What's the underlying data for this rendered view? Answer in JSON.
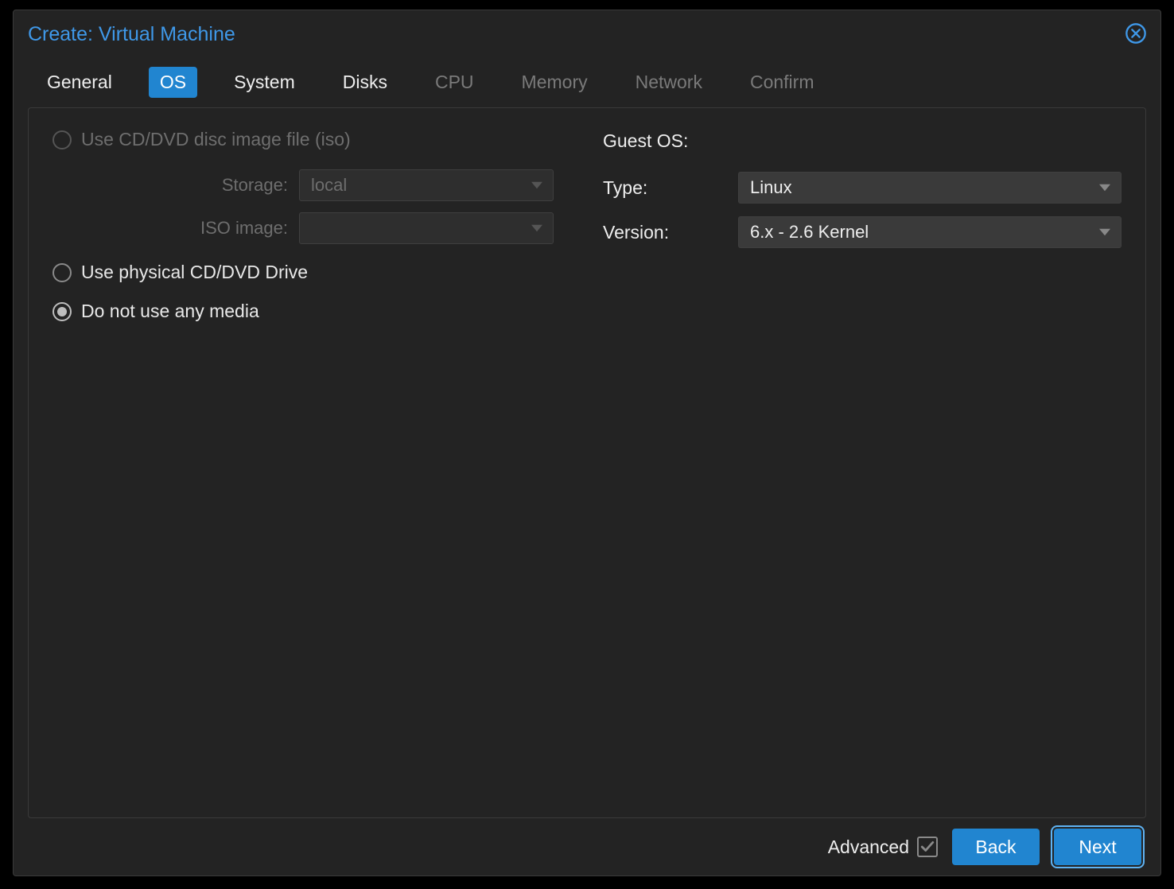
{
  "dialog": {
    "title": "Create: Virtual Machine"
  },
  "tabs": {
    "general": "General",
    "os": "OS",
    "system": "System",
    "disks": "Disks",
    "cpu": "CPU",
    "memory": "Memory",
    "network": "Network",
    "confirm": "Confirm"
  },
  "media": {
    "use_iso": "Use CD/DVD disc image file (iso)",
    "storage_label": "Storage:",
    "storage_value": "local",
    "iso_image_label": "ISO image:",
    "iso_image_value": "",
    "use_physical": "Use physical CD/DVD Drive",
    "no_media": "Do not use any media"
  },
  "guest_os": {
    "heading": "Guest OS:",
    "type_label": "Type:",
    "type_value": "Linux",
    "version_label": "Version:",
    "version_value": "6.x - 2.6 Kernel"
  },
  "footer": {
    "advanced": "Advanced",
    "back": "Back",
    "next": "Next"
  }
}
